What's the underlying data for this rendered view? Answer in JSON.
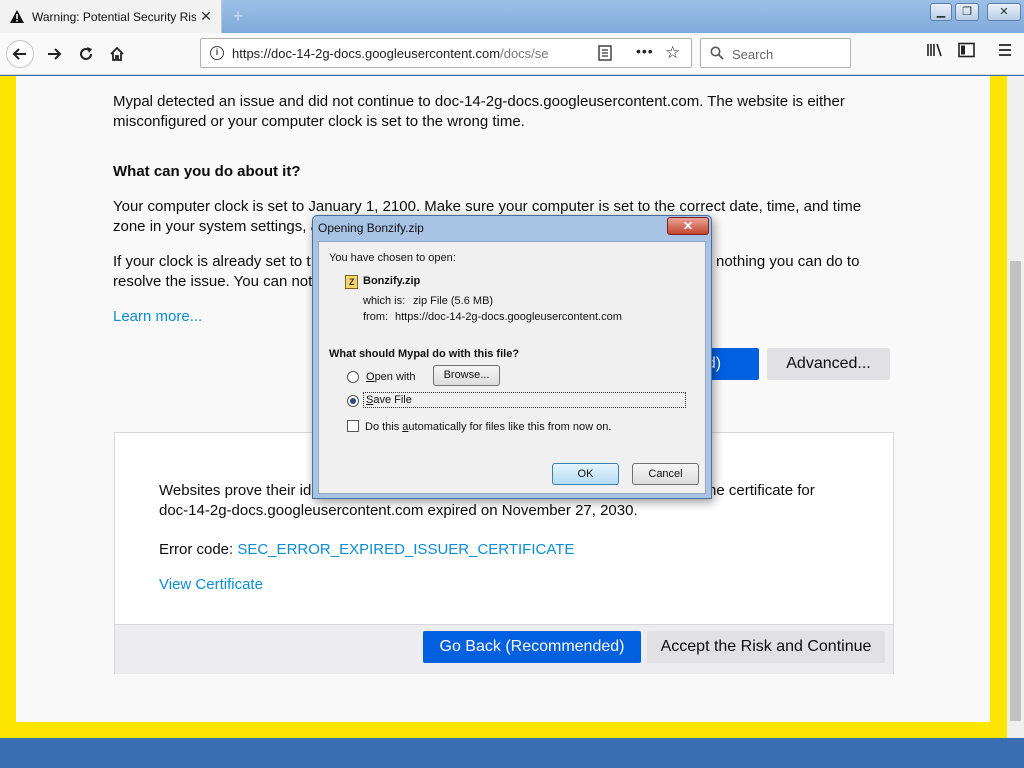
{
  "tab": {
    "title": "Warning: Potential Security Risk Ahead",
    "close": "✕",
    "new": "+"
  },
  "window_controls": {
    "minimize": "▁",
    "maximize": "❐",
    "close": "✕"
  },
  "url": {
    "host": "https://doc-14-2g-docs.googleusercontent.com",
    "path": "/docs/se"
  },
  "search": {
    "placeholder": "Search"
  },
  "page": {
    "intro": "Mypal detected an issue and did not continue to doc-14-2g-docs.googleusercontent.com. The website is either misconfigured or your computer clock is set to the wrong time.",
    "what_heading": "What can you do about it?",
    "clock_text": "Your computer clock is set to January 1, 2100. Make sure your computer is set to the correct date, time, and time zone in your system settings, and th",
    "clock_text_2": "If your clock is already set to t",
    "clock_text_2_end": "nothing you can do to",
    "clock_text_3": "resolve the issue. You can notif",
    "learn_more": "Learn more...",
    "go_back_partial": "ed)",
    "advanced": "Advanced...",
    "panel_text_1": "Websites prove their id",
    "panel_text_1_end": "ne certificate for",
    "panel_text_2": "doc-14-2g-docs.googleusercontent.com expired on November 27, 2030.",
    "error_code_label": "Error code: ",
    "error_code": "SEC_ERROR_EXPIRED_ISSUER_CERTIFICATE",
    "view_certificate": "View Certificate",
    "go_back": "Go Back (Recommended)",
    "accept_risk": "Accept the Risk and Continue"
  },
  "dialog": {
    "title": "Opening Bonzify.zip",
    "chosen": "You have chosen to open:",
    "filename": "Bonzify.zip",
    "which_label": "which is:",
    "which_value": "zip File (5.6 MB)",
    "from_label": "from:",
    "from_value": "https://doc-14-2g-docs.googleusercontent.com",
    "question": "What should Mypal do with this file?",
    "open_with_u": "O",
    "open_with_rest": "pen with",
    "browse": "Browse...",
    "save_u": "S",
    "save_rest": "ave File",
    "auto_pre": "Do this ",
    "auto_u": "a",
    "auto_rest": "utomatically for files like this from now on.",
    "ok": "OK",
    "cancel": "Cancel",
    "selected_option": "Save File"
  }
}
